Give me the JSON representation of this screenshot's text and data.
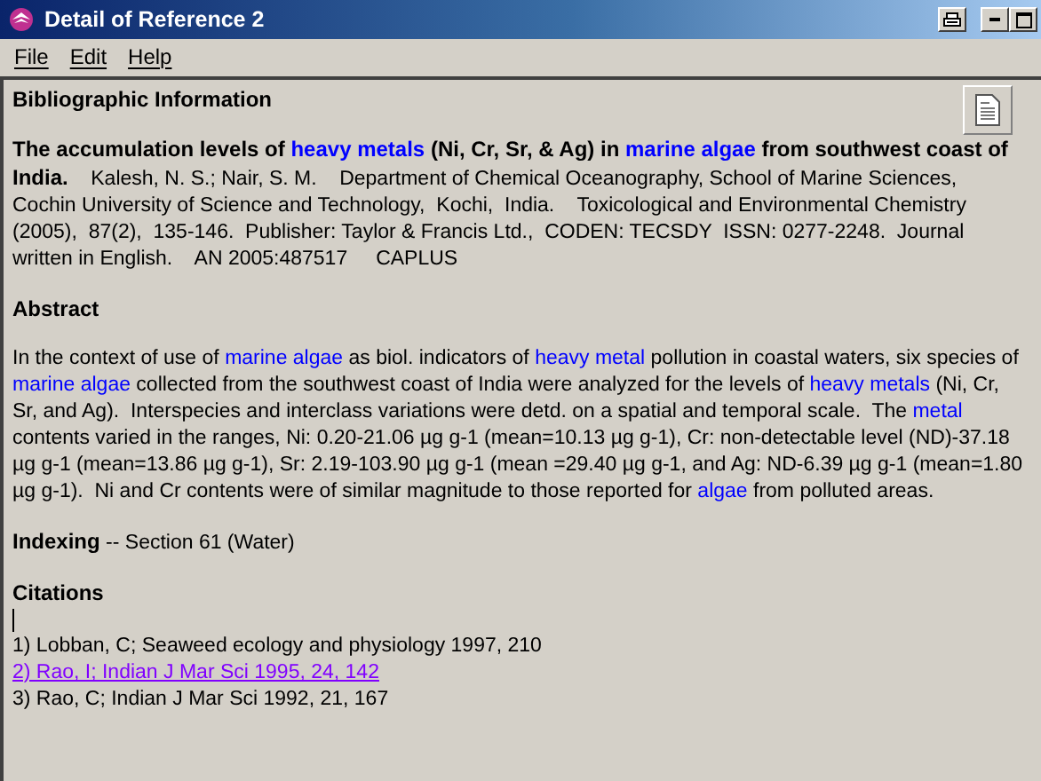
{
  "window": {
    "title": "Detail of Reference 2"
  },
  "menu": [
    "File",
    "Edit",
    "Help"
  ],
  "bibliographic": {
    "heading": "Bibliographic Information",
    "title": [
      {
        "kind": "plain",
        "text": "The accumulation levels of "
      },
      {
        "kind": "link",
        "text": "heavy metals"
      },
      {
        "kind": "plain",
        "text": " (Ni, Cr, Sr, & Ag) in "
      },
      {
        "kind": "link",
        "text": "marine algae"
      },
      {
        "kind": "plain",
        "text": " from southwest coast of India."
      }
    ],
    "details": "Kalesh, N. S.; Nair, S. M.    Department of Chemical Oceanography, School of Marine Sciences,  Cochin University of Science and Technology,  Kochi,  India.    Toxicological and Environmental Chemistry  (2005),  87(2),  135-146.  Publisher: Taylor & Francis Ltd.,  CODEN: TECSDY  ISSN: 0277-2248.  Journal  written in English.    AN 2005:487517     CAPLUS"
  },
  "abstract": {
    "heading": "Abstract",
    "text": [
      {
        "kind": "plain",
        "text": "In the context of use of "
      },
      {
        "kind": "link",
        "text": "marine algae"
      },
      {
        "kind": "plain",
        "text": " as biol. indicators of "
      },
      {
        "kind": "link",
        "text": "heavy metal"
      },
      {
        "kind": "plain",
        "text": " pollution in coastal waters, six species of "
      },
      {
        "kind": "link",
        "text": "marine algae"
      },
      {
        "kind": "plain",
        "text": " collected from the southwest coast of India were analyzed for the levels of "
      },
      {
        "kind": "link",
        "text": "heavy metals"
      },
      {
        "kind": "plain",
        "text": " (Ni, Cr, Sr, and Ag).  Interspecies and interclass variations were detd. on a spatial and temporal scale.  The "
      },
      {
        "kind": "link",
        "text": "metal"
      },
      {
        "kind": "plain",
        "text": " contents varied in the ranges, Ni: 0.20-21.06 µg g-1 (mean=10.13 µg g-1), Cr: non-detectable level (ND)-37.18 µg g-1 (mean=13.86 µg g-1), Sr: 2.19-103.90 µg g-1 (mean =29.40 µg g-1, and Ag: ND-6.39 µg g-1 (mean=1.80 µg g-1).  Ni and Cr contents were of similar magnitude to those reported for "
      },
      {
        "kind": "link",
        "text": "algae"
      },
      {
        "kind": "plain",
        "text": " from polluted areas."
      }
    ]
  },
  "indexing": {
    "heading": "Indexing",
    "text": "-- Section 61  (Water)"
  },
  "citations": {
    "heading": "Citations",
    "items": [
      {
        "text": "1) Lobban, C; Seaweed ecology and physiology 1997, 210",
        "visited": false
      },
      {
        "text": "2) Rao, I; Indian J Mar Sci 1995, 24, 142",
        "visited": true
      },
      {
        "text": "3) Rao, C; Indian J Mar Sci 1992, 21, 167",
        "visited": false
      }
    ]
  }
}
